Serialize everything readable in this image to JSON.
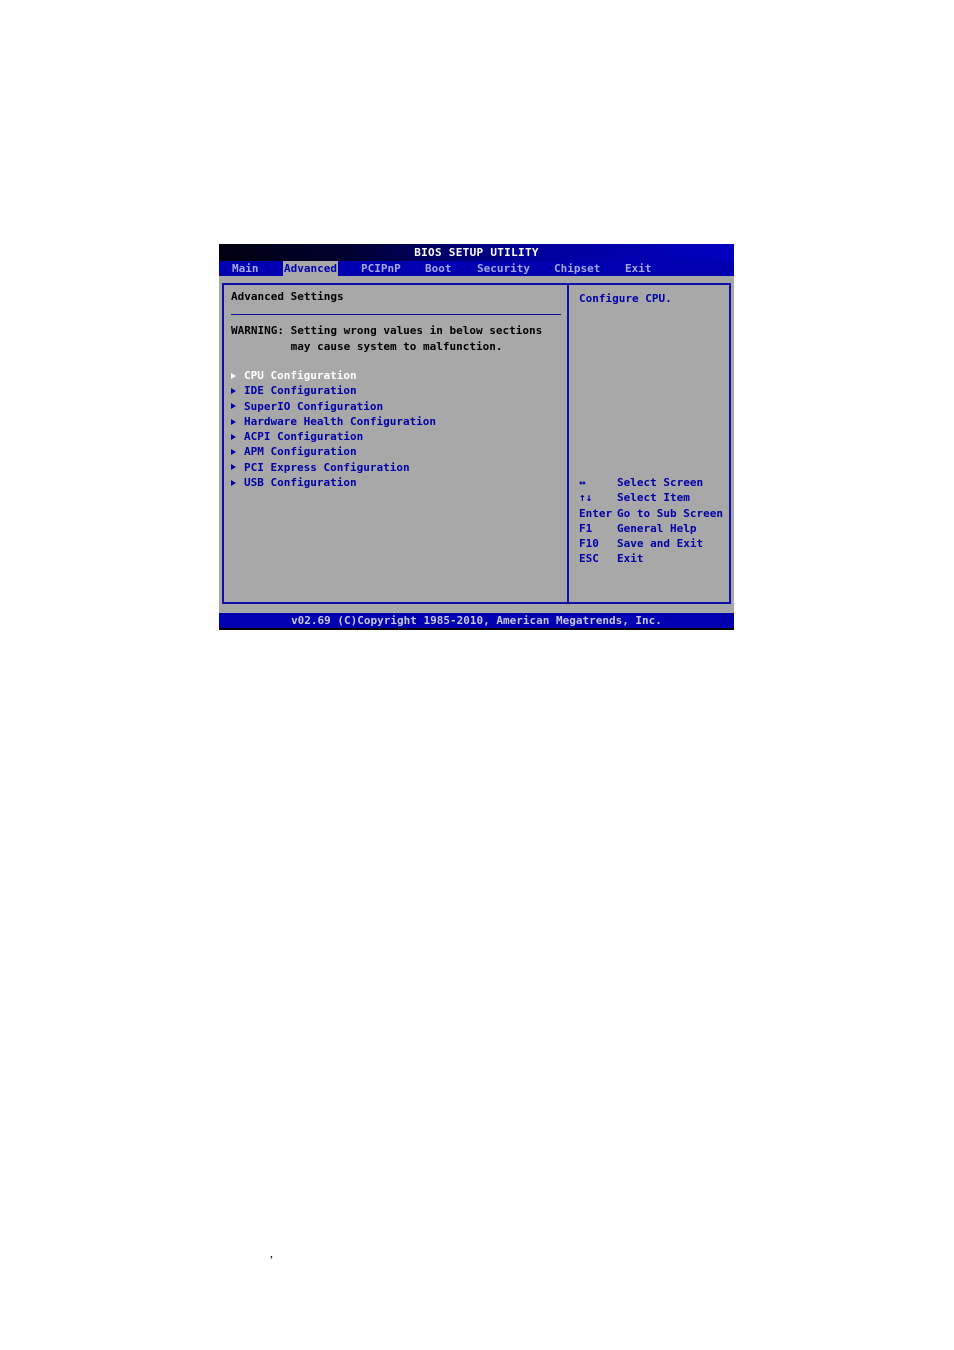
{
  "title": "BIOS SETUP UTILITY",
  "tabs": [
    {
      "label": "Main",
      "active": false
    },
    {
      "label": "Advanced",
      "active": true
    },
    {
      "label": "PCIPnP",
      "active": false
    },
    {
      "label": "Boot",
      "active": false
    },
    {
      "label": "Security",
      "active": false
    },
    {
      "label": "Chipset",
      "active": false
    },
    {
      "label": "Exit",
      "active": false
    }
  ],
  "main": {
    "heading": "Advanced Settings",
    "warning_line1": "WARNING: Setting wrong values in below sections",
    "warning_line2": "         may cause system to malfunction.",
    "items": [
      {
        "label": "CPU Configuration",
        "selected": true
      },
      {
        "label": "IDE Configuration",
        "selected": false
      },
      {
        "label": "SuperIO Configuration",
        "selected": false
      },
      {
        "label": "Hardware Health Configuration",
        "selected": false
      },
      {
        "label": "ACPI Configuration",
        "selected": false
      },
      {
        "label": "APM Configuration",
        "selected": false
      },
      {
        "label": "PCI Express Configuration",
        "selected": false
      },
      {
        "label": "USB Configuration",
        "selected": false
      }
    ]
  },
  "help": {
    "description": "Configure CPU.",
    "keys": [
      {
        "key": "↔",
        "action": "Select Screen"
      },
      {
        "key": "↑↓",
        "action": "Select Item"
      },
      {
        "key": "Enter",
        "action": "Go to Sub Screen"
      },
      {
        "key": "F1",
        "action": "General Help"
      },
      {
        "key": "F10",
        "action": "Save and Exit"
      },
      {
        "key": "ESC",
        "action": "Exit"
      }
    ]
  },
  "footer": "v02.69 (C)Copyright 1985-2010, American Megatrends, Inc.",
  "stray_mark": ","
}
